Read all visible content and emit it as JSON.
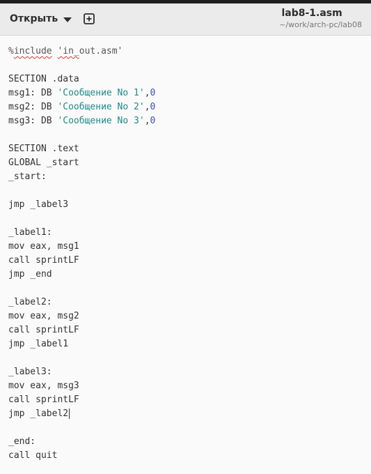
{
  "header": {
    "open_label": "Открыть",
    "file_title": "lab8-1.asm",
    "file_path": "~/work/arch-pc/lab08"
  },
  "editor": {
    "lines": [
      "%include 'in_out.asm'",
      "",
      "SECTION .data",
      "msg1: DB 'Сообщение No 1',0",
      "msg2: DB 'Сообщение No 2',0",
      "msg3: DB 'Сообщение No 3',0",
      "",
      "SECTION .text",
      "GLOBAL _start",
      "_start:",
      "",
      "jmp _label3",
      "",
      "_label1:",
      "mov eax, msg1",
      "call sprintLF",
      "jmp _end",
      "",
      "_label2:",
      "mov eax, msg2",
      "call sprintLF",
      "jmp _label1",
      "",
      "_label3:",
      "mov eax, msg3",
      "call sprintLF",
      "jmp _label2",
      "",
      "_end:",
      "call quit"
    ]
  },
  "colors": {
    "string": "#1f8a8a",
    "number": "#3b4fb8",
    "header_bg": "#ebebeb",
    "editor_bg": "#fafafa"
  },
  "icons": {
    "open_menu": "chevron-down-icon",
    "new_tab": "plus-square-icon"
  }
}
